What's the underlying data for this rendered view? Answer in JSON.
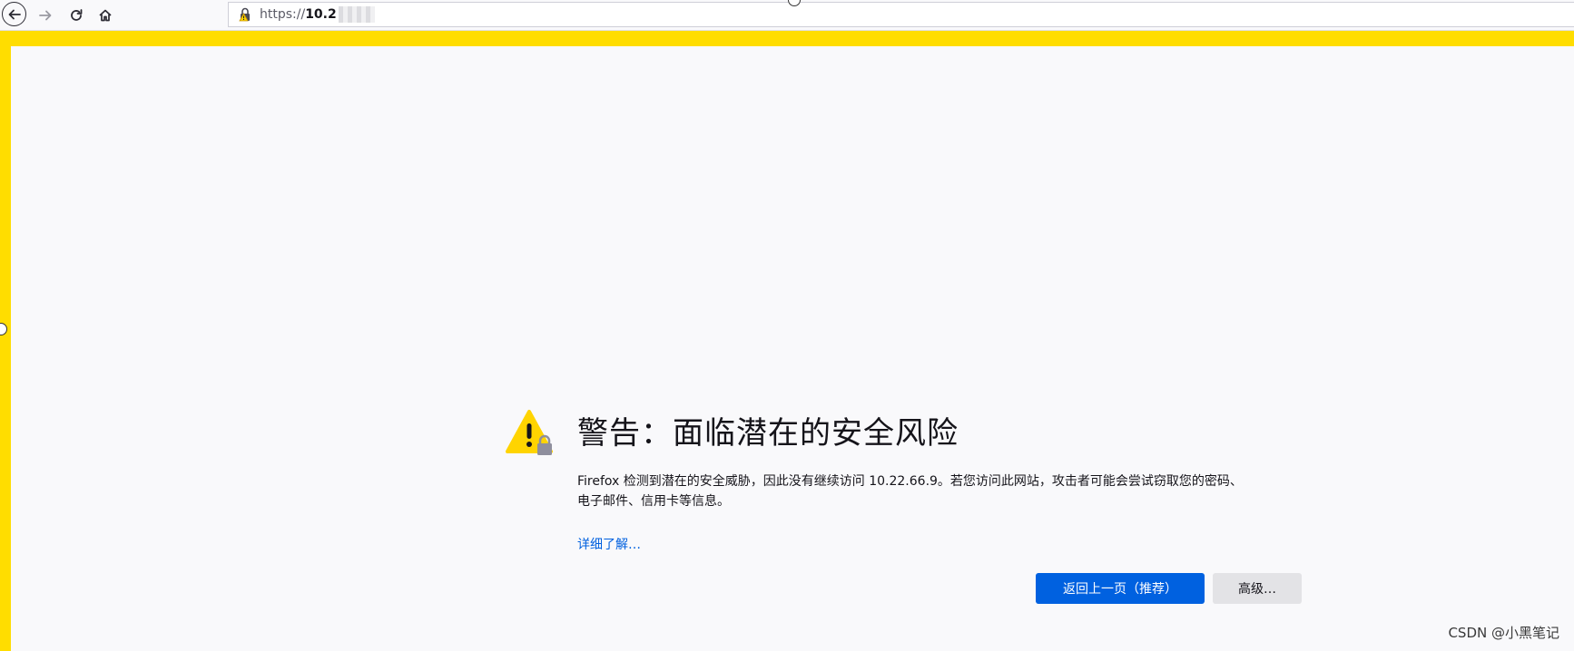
{
  "browser": {
    "url_prefix": "https://",
    "url_host": "10.2",
    "icons": {
      "back": "back-arrow-icon",
      "forward": "forward-arrow-icon",
      "reload": "reload-icon",
      "home": "home-icon",
      "lock": "warning-lock-icon"
    }
  },
  "error_page": {
    "title": "警告：面临潜在的安全风险",
    "description_line1": "Firefox 检测到潜在的安全威胁，因此没有继续访问 10.22.66.9。若您访问此网站，攻击者可能会尝试窃取您的密码、",
    "description_line2": "电子邮件、信用卡等信息。",
    "learn_more": "详细了解…",
    "go_back_button": "返回上一页（推荐）",
    "advanced_button": "高级…"
  },
  "watermark": "CSDN @小黑笔记",
  "colors": {
    "frame_border": "#ffdd00",
    "page_bg": "#f9f9fb",
    "primary_button": "#0061e0",
    "link": "#0060df",
    "warning_yellow": "#ffd400"
  }
}
